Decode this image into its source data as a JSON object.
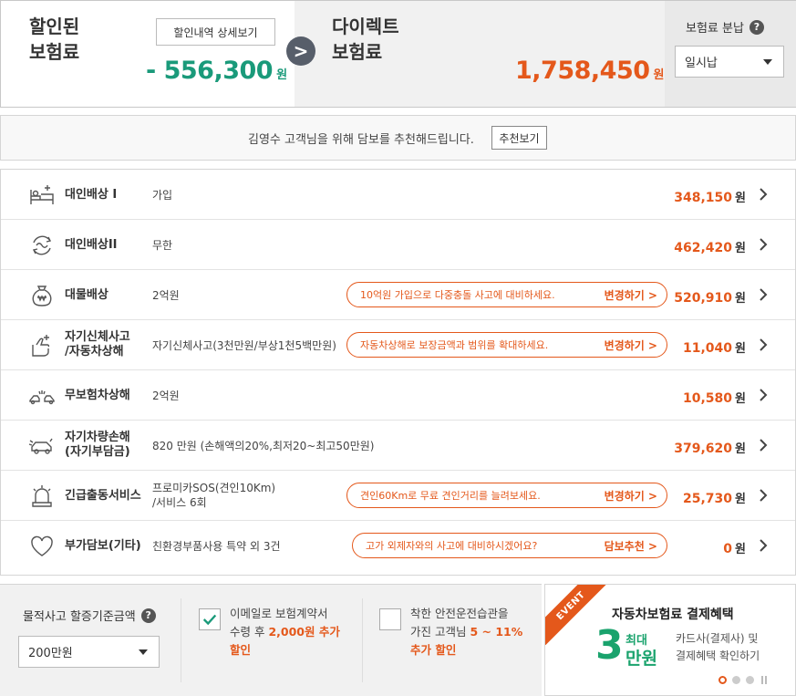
{
  "summary": {
    "discount_title_line1": "할인된",
    "discount_title_line2": "보험료",
    "detail_button": "할인내역 상세보기",
    "discount_amount": "- 556,300",
    "discount_unit": "원",
    "direct_title_line1": "다이렉트",
    "direct_title_line2": "보험료",
    "direct_amount": "1,758,450",
    "direct_unit": "원",
    "payment_label": "보험료 분납",
    "payment_help": "?",
    "payment_select": "일시납",
    "arrow": ">"
  },
  "recommend": {
    "text": "김영수 고객님을 위해 담보를 추천해드립니다.",
    "button": "추천보기"
  },
  "coverages": [
    {
      "name1": "대인배상 I",
      "name2": "",
      "value1": "가입",
      "value2": "",
      "tip": "",
      "tip_action": "",
      "price": "348,150",
      "unit": "원",
      "icon": "bed-plus-icon"
    },
    {
      "name1": "대인배상II",
      "name2": "",
      "value1": "무한",
      "value2": "",
      "tip": "",
      "tip_action": "",
      "price": "462,420",
      "unit": "원",
      "icon": "infinity-cycle-icon"
    },
    {
      "name1": "대물배상",
      "name2": "",
      "value1": "2억원",
      "value2": "",
      "tip": "10억원 가입으로 다중충돌 사고에 대비하세요.",
      "tip_action": "변경하기 >",
      "price": "520,910",
      "unit": "원",
      "icon": "money-bag-icon"
    },
    {
      "name1": "자기신체사고",
      "name2": "/자동차상해",
      "value1": "자기신체사고(3천만원/부상1천5백만원)",
      "value2": "",
      "tip": "자동차상해로 보장금액과 범위를 확대하세요.",
      "tip_action": "변경하기 >",
      "price": "11,040",
      "unit": "원",
      "icon": "hand-plus-icon"
    },
    {
      "name1": "무보험차상해",
      "name2": "",
      "value1": "2억원",
      "value2": "",
      "tip": "",
      "tip_action": "",
      "price": "10,580",
      "unit": "원",
      "icon": "car-crash-icon"
    },
    {
      "name1": "자기차량손해",
      "name2": "(자기부담금)",
      "value1": "820 만원 (손해액의20%,최저20~최고50만원)",
      "value2": "",
      "tip": "",
      "tip_action": "",
      "price": "379,620",
      "unit": "원",
      "icon": "car-damage-icon"
    },
    {
      "name1": "긴급출동서비스",
      "name2": "",
      "value1": "프로미카SOS(견인10Km)",
      "value2": "/서비스 6회",
      "tip": "견인60Km로 무료 견인거리를 늘려보세요.",
      "tip_action": "변경하기 >",
      "price": "25,730",
      "unit": "원",
      "icon": "siren-icon"
    },
    {
      "name1": "부가담보(기타)",
      "name2": "",
      "value1": "친환경부품사용 특약 외 3건",
      "value2": "",
      "tip": "고가 외제자와의 사고에 대비하시겠어요?",
      "tip_action": "담보추천 >",
      "price": "0",
      "unit": "원",
      "icon": "heart-icon"
    }
  ],
  "property": {
    "label": "물적사고 할증기준금액",
    "help": "?",
    "select": "200만원"
  },
  "email_option": {
    "checked": true,
    "line1": "이메일로 보험계약서",
    "line2_a": "수령 후 ",
    "line2_hl": "2,000원 추가",
    "line3_hl": "할인"
  },
  "safe_option": {
    "checked": false,
    "line1": "착한 안전운전습관을",
    "line2_a": "가진 고객님 ",
    "line2_hl": "5 ~ 11%",
    "line3_hl": "추가 할인"
  },
  "event": {
    "ribbon": "EVENT",
    "title": "자동차보험료 결제혜택",
    "big_number": "3",
    "max_label": "최대",
    "amount_label": "만원",
    "desc_line1": "카드사(결제사) 및",
    "desc_line2": "결제혜택 확인하기",
    "active_slide": 1,
    "slide_count": 3
  },
  "colors": {
    "accent_orange": "#e4581b",
    "accent_green": "#1a9a7a",
    "event_green": "#1aa36d"
  }
}
